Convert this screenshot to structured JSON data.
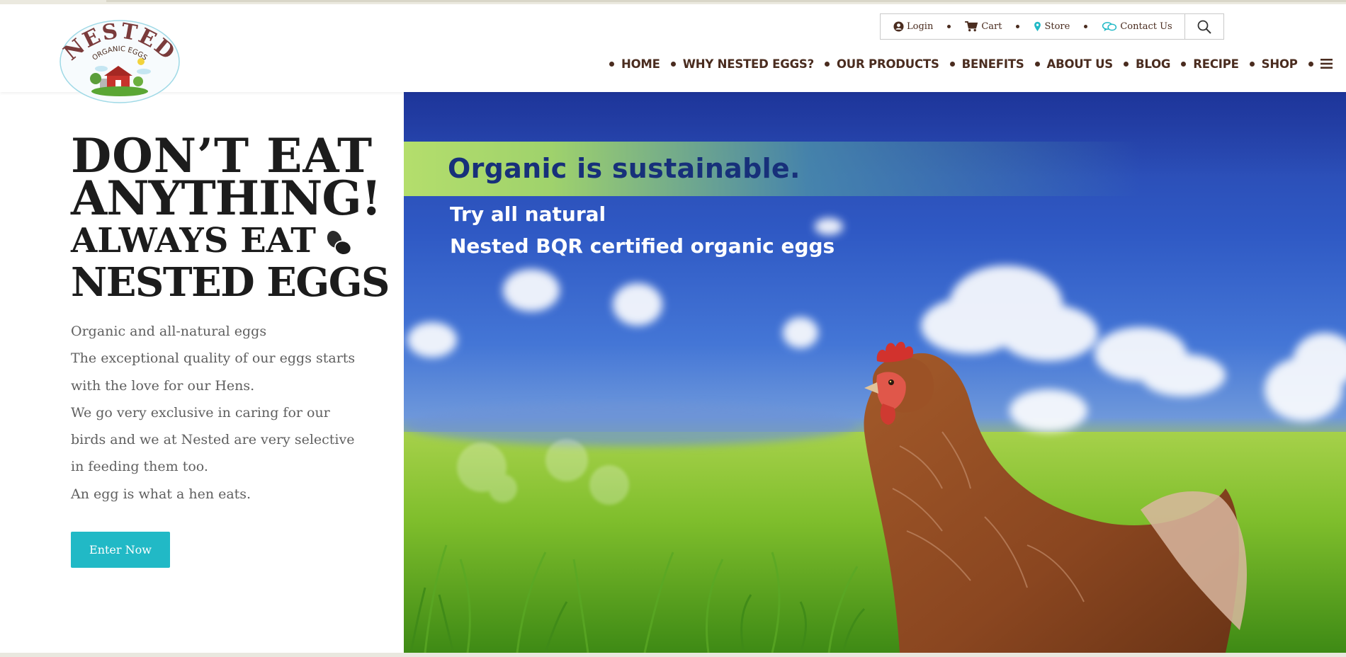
{
  "brand": {
    "name": "NESTED",
    "tagline": "ORGANIC EGGS"
  },
  "utility": {
    "items": [
      {
        "label": "Login",
        "icon": "user-circle-icon"
      },
      {
        "label": "Cart",
        "icon": "cart-icon"
      },
      {
        "label": "Store",
        "icon": "map-pin-icon"
      },
      {
        "label": "Contact Us",
        "icon": "chat-bubbles-icon"
      }
    ],
    "search_icon": "search-icon"
  },
  "nav": {
    "items": [
      {
        "label": "HOME"
      },
      {
        "label": "WHY NESTED EGGS?"
      },
      {
        "label": "OUR PRODUCTS"
      },
      {
        "label": "BENEFITS"
      },
      {
        "label": "ABOUT US"
      },
      {
        "label": "BLOG"
      },
      {
        "label": "RECIPE"
      },
      {
        "label": "SHOP"
      }
    ],
    "menu_icon": "hamburger-menu-icon"
  },
  "intro": {
    "headline": {
      "line1": "DON’T EAT",
      "line2": "ANYTHING!",
      "line3": "ALWAYS EAT",
      "line4": "NESTED EGGS"
    },
    "paragraphs": [
      "Organic and all-natural eggs",
      "The exceptional quality of our eggs starts",
      "with the love for our Hens.",
      "We go very exclusive in caring for our",
      "birds and we at Nested are very selective",
      "in feeding them too.",
      "An egg is what a hen eats."
    ],
    "cta_label": "Enter Now"
  },
  "hero": {
    "title": "Organic is sustainable.",
    "subtitle_line1": "Try all natural",
    "subtitle_line2": "Nested BQR certified organic eggs"
  },
  "colors": {
    "brand_brown": "#4a2c1f",
    "accent_teal": "#21b9c6",
    "headline_black": "#1c1c1c",
    "body_grey": "#5f5f5f",
    "hero_title_navy": "#17307a"
  }
}
